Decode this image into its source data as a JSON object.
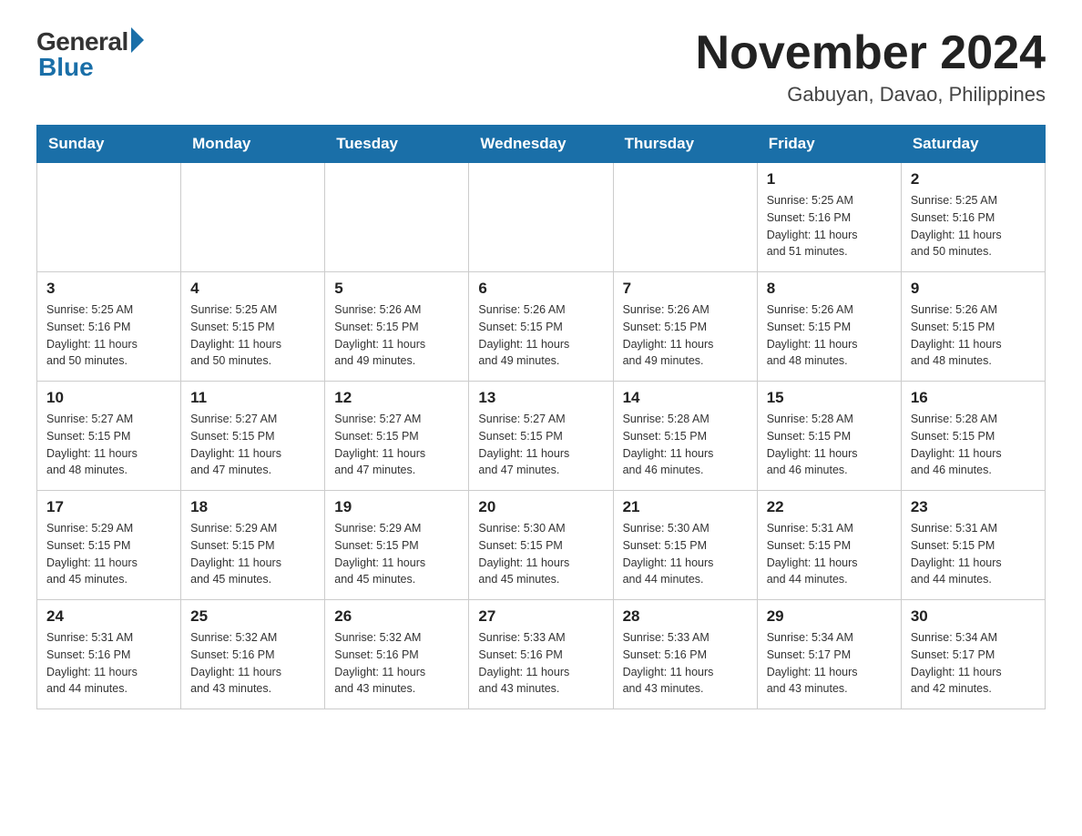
{
  "header": {
    "logo_general": "General",
    "logo_blue": "Blue",
    "month_title": "November 2024",
    "location": "Gabuyan, Davao, Philippines"
  },
  "weekdays": [
    "Sunday",
    "Monday",
    "Tuesday",
    "Wednesday",
    "Thursday",
    "Friday",
    "Saturday"
  ],
  "weeks": [
    [
      {
        "day": "",
        "info": ""
      },
      {
        "day": "",
        "info": ""
      },
      {
        "day": "",
        "info": ""
      },
      {
        "day": "",
        "info": ""
      },
      {
        "day": "",
        "info": ""
      },
      {
        "day": "1",
        "info": "Sunrise: 5:25 AM\nSunset: 5:16 PM\nDaylight: 11 hours\nand 51 minutes."
      },
      {
        "day": "2",
        "info": "Sunrise: 5:25 AM\nSunset: 5:16 PM\nDaylight: 11 hours\nand 50 minutes."
      }
    ],
    [
      {
        "day": "3",
        "info": "Sunrise: 5:25 AM\nSunset: 5:16 PM\nDaylight: 11 hours\nand 50 minutes."
      },
      {
        "day": "4",
        "info": "Sunrise: 5:25 AM\nSunset: 5:15 PM\nDaylight: 11 hours\nand 50 minutes."
      },
      {
        "day": "5",
        "info": "Sunrise: 5:26 AM\nSunset: 5:15 PM\nDaylight: 11 hours\nand 49 minutes."
      },
      {
        "day": "6",
        "info": "Sunrise: 5:26 AM\nSunset: 5:15 PM\nDaylight: 11 hours\nand 49 minutes."
      },
      {
        "day": "7",
        "info": "Sunrise: 5:26 AM\nSunset: 5:15 PM\nDaylight: 11 hours\nand 49 minutes."
      },
      {
        "day": "8",
        "info": "Sunrise: 5:26 AM\nSunset: 5:15 PM\nDaylight: 11 hours\nand 48 minutes."
      },
      {
        "day": "9",
        "info": "Sunrise: 5:26 AM\nSunset: 5:15 PM\nDaylight: 11 hours\nand 48 minutes."
      }
    ],
    [
      {
        "day": "10",
        "info": "Sunrise: 5:27 AM\nSunset: 5:15 PM\nDaylight: 11 hours\nand 48 minutes."
      },
      {
        "day": "11",
        "info": "Sunrise: 5:27 AM\nSunset: 5:15 PM\nDaylight: 11 hours\nand 47 minutes."
      },
      {
        "day": "12",
        "info": "Sunrise: 5:27 AM\nSunset: 5:15 PM\nDaylight: 11 hours\nand 47 minutes."
      },
      {
        "day": "13",
        "info": "Sunrise: 5:27 AM\nSunset: 5:15 PM\nDaylight: 11 hours\nand 47 minutes."
      },
      {
        "day": "14",
        "info": "Sunrise: 5:28 AM\nSunset: 5:15 PM\nDaylight: 11 hours\nand 46 minutes."
      },
      {
        "day": "15",
        "info": "Sunrise: 5:28 AM\nSunset: 5:15 PM\nDaylight: 11 hours\nand 46 minutes."
      },
      {
        "day": "16",
        "info": "Sunrise: 5:28 AM\nSunset: 5:15 PM\nDaylight: 11 hours\nand 46 minutes."
      }
    ],
    [
      {
        "day": "17",
        "info": "Sunrise: 5:29 AM\nSunset: 5:15 PM\nDaylight: 11 hours\nand 45 minutes."
      },
      {
        "day": "18",
        "info": "Sunrise: 5:29 AM\nSunset: 5:15 PM\nDaylight: 11 hours\nand 45 minutes."
      },
      {
        "day": "19",
        "info": "Sunrise: 5:29 AM\nSunset: 5:15 PM\nDaylight: 11 hours\nand 45 minutes."
      },
      {
        "day": "20",
        "info": "Sunrise: 5:30 AM\nSunset: 5:15 PM\nDaylight: 11 hours\nand 45 minutes."
      },
      {
        "day": "21",
        "info": "Sunrise: 5:30 AM\nSunset: 5:15 PM\nDaylight: 11 hours\nand 44 minutes."
      },
      {
        "day": "22",
        "info": "Sunrise: 5:31 AM\nSunset: 5:15 PM\nDaylight: 11 hours\nand 44 minutes."
      },
      {
        "day": "23",
        "info": "Sunrise: 5:31 AM\nSunset: 5:15 PM\nDaylight: 11 hours\nand 44 minutes."
      }
    ],
    [
      {
        "day": "24",
        "info": "Sunrise: 5:31 AM\nSunset: 5:16 PM\nDaylight: 11 hours\nand 44 minutes."
      },
      {
        "day": "25",
        "info": "Sunrise: 5:32 AM\nSunset: 5:16 PM\nDaylight: 11 hours\nand 43 minutes."
      },
      {
        "day": "26",
        "info": "Sunrise: 5:32 AM\nSunset: 5:16 PM\nDaylight: 11 hours\nand 43 minutes."
      },
      {
        "day": "27",
        "info": "Sunrise: 5:33 AM\nSunset: 5:16 PM\nDaylight: 11 hours\nand 43 minutes."
      },
      {
        "day": "28",
        "info": "Sunrise: 5:33 AM\nSunset: 5:16 PM\nDaylight: 11 hours\nand 43 minutes."
      },
      {
        "day": "29",
        "info": "Sunrise: 5:34 AM\nSunset: 5:17 PM\nDaylight: 11 hours\nand 43 minutes."
      },
      {
        "day": "30",
        "info": "Sunrise: 5:34 AM\nSunset: 5:17 PM\nDaylight: 11 hours\nand 42 minutes."
      }
    ]
  ]
}
